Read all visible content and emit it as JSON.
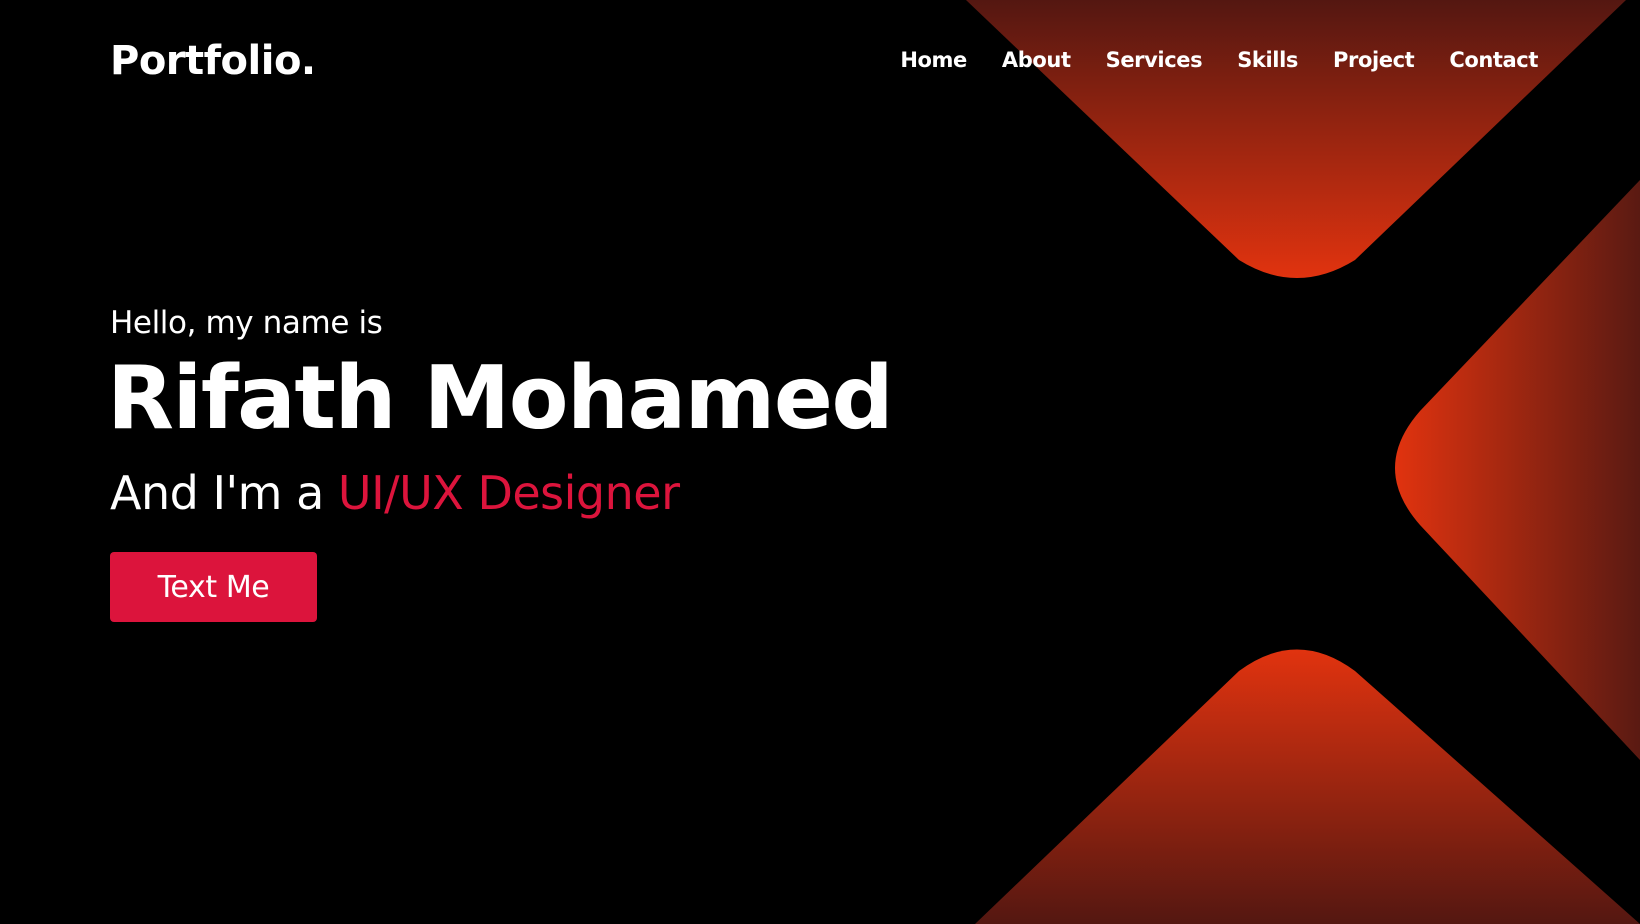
{
  "brand": {
    "logo_text": "Portfolio."
  },
  "nav": {
    "items": [
      {
        "label": "Home"
      },
      {
        "label": "About"
      },
      {
        "label": "Services"
      },
      {
        "label": "Skills"
      },
      {
        "label": "Project"
      },
      {
        "label": "Contact"
      }
    ]
  },
  "hero": {
    "greeting": "Hello, my name is",
    "name": "Rifath Mohamed",
    "role_prefix": "And I'm a ",
    "role": "UI/UX Designer",
    "cta_label": "Text Me"
  },
  "colors": {
    "background": "#000000",
    "accent": "#dc143c",
    "shape_bright": "#e0310f",
    "shape_dark": "#5a1a12"
  }
}
